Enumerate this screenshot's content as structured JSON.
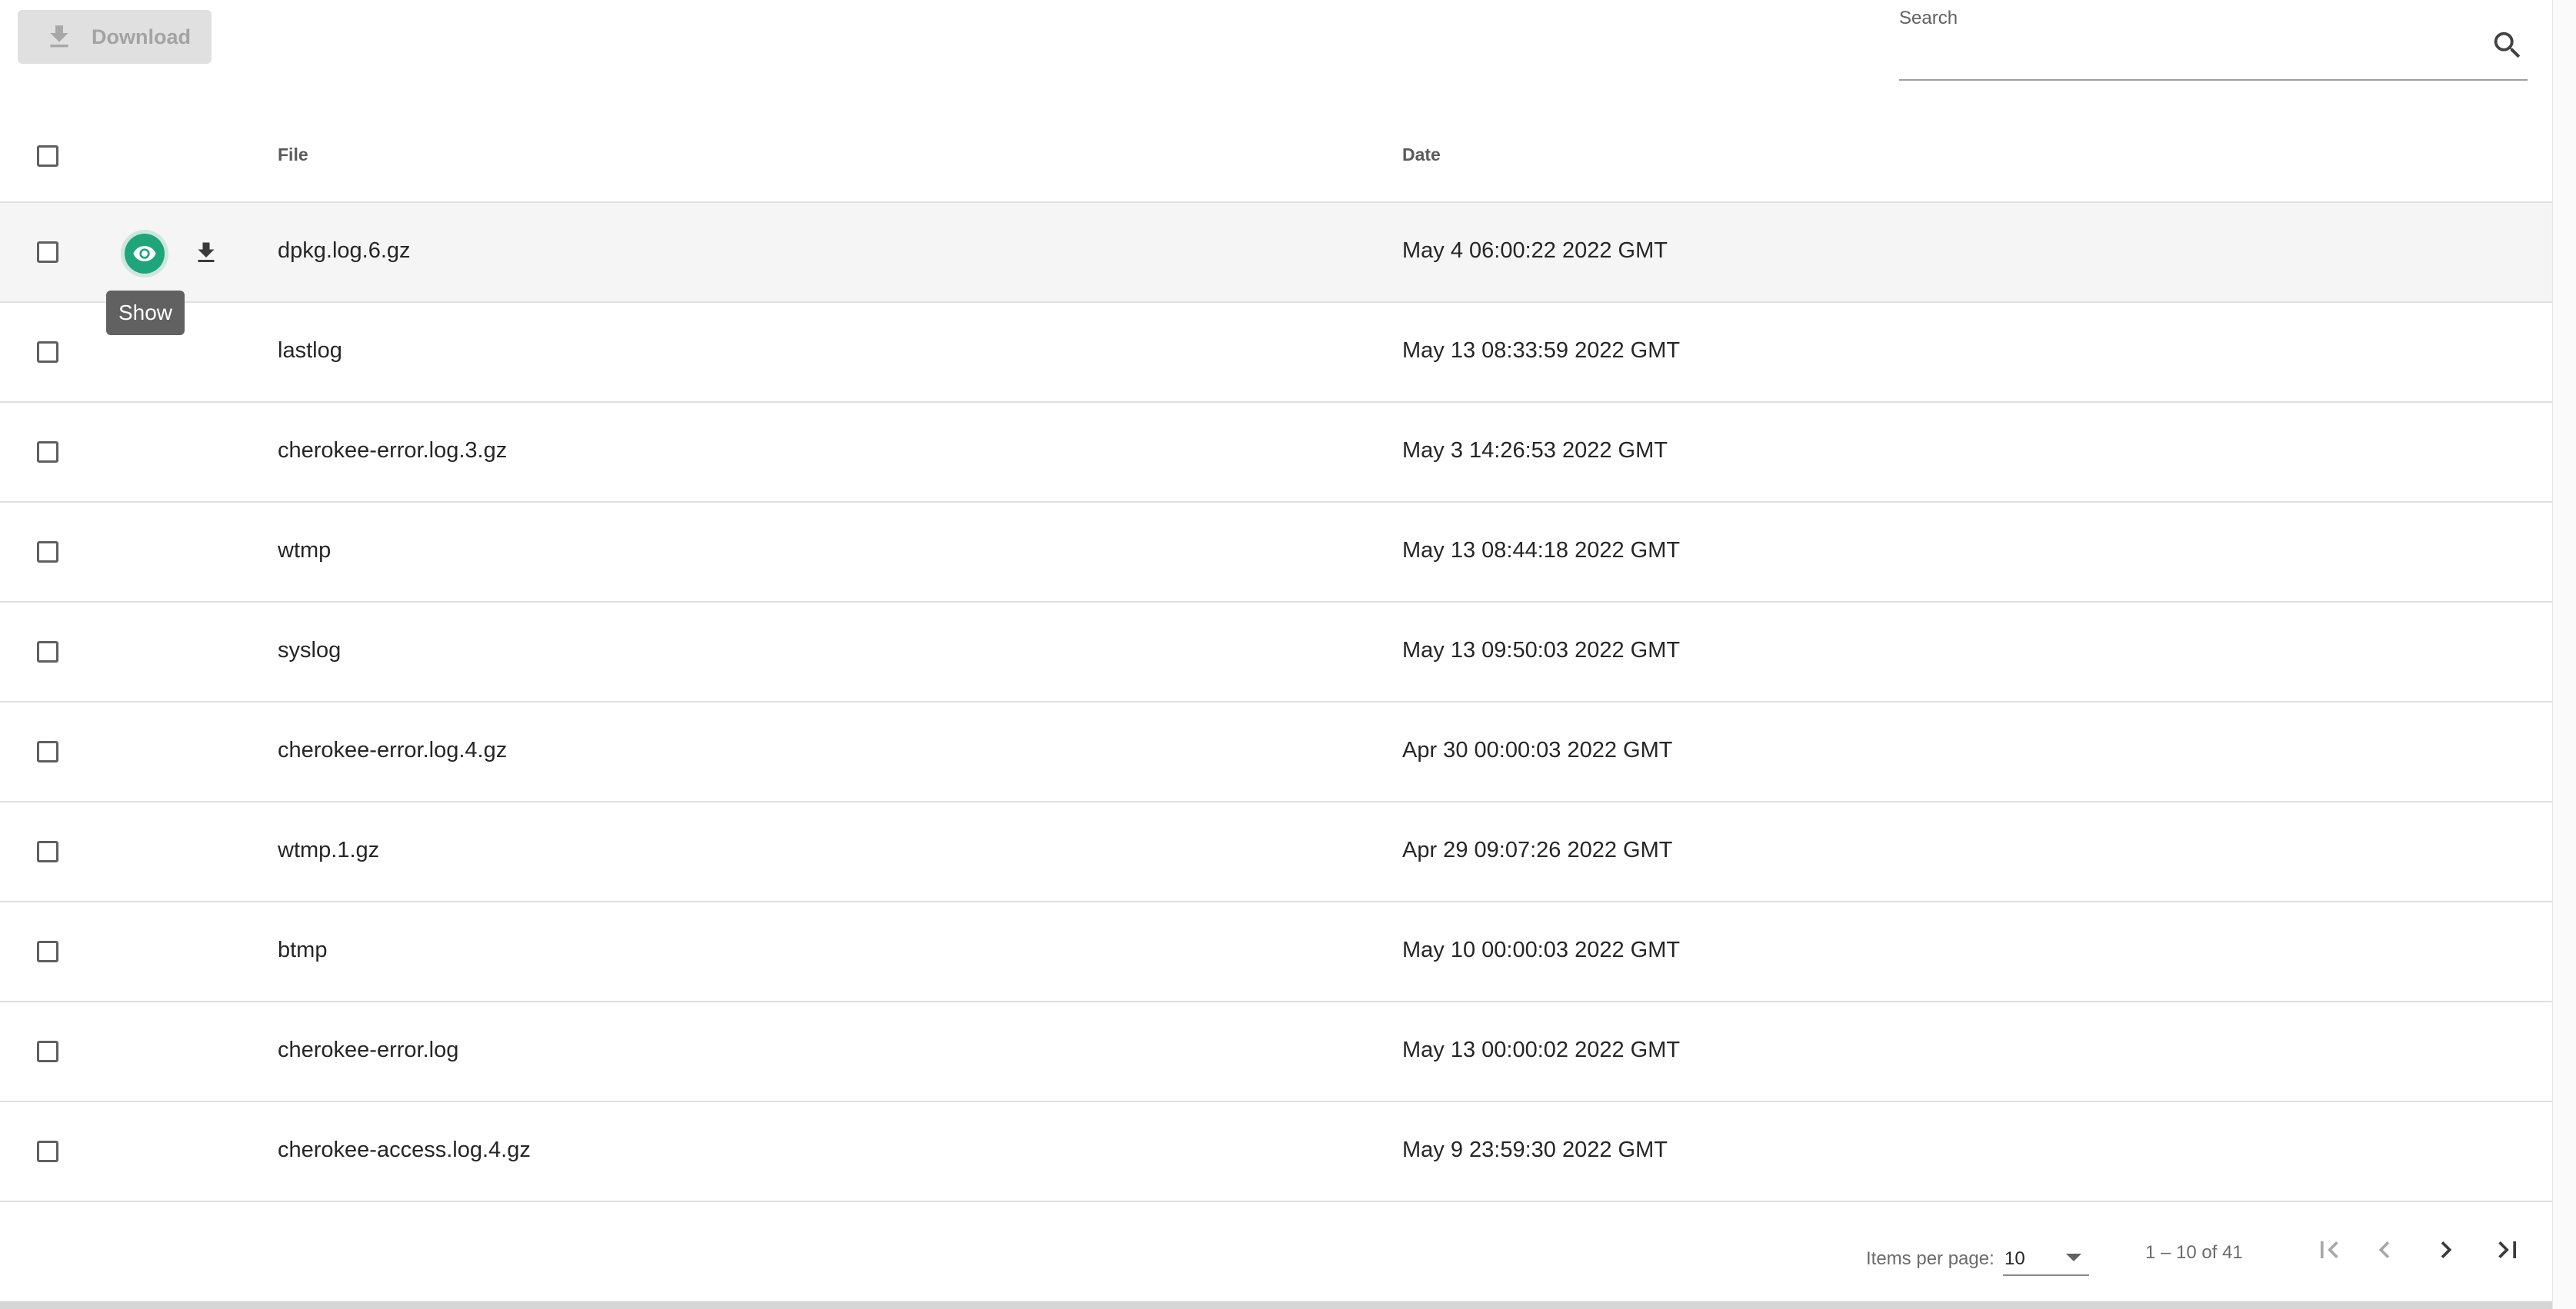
{
  "toolbar": {
    "download_label": "Download",
    "download_icon": "download-icon"
  },
  "search": {
    "label": "Search",
    "value": "",
    "icon": "search-icon"
  },
  "table": {
    "columns": {
      "file": "File",
      "date": "Date"
    },
    "rows": [
      {
        "file": "dpkg.log.6.gz",
        "date": "May 4 06:00:22 2022 GMT"
      },
      {
        "file": "lastlog",
        "date": "May 13 08:33:59 2022 GMT"
      },
      {
        "file": "cherokee-error.log.3.gz",
        "date": "May 3 14:26:53 2022 GMT"
      },
      {
        "file": "wtmp",
        "date": "May 13 08:44:18 2022 GMT"
      },
      {
        "file": "syslog",
        "date": "May 13 09:50:03 2022 GMT"
      },
      {
        "file": "cherokee-error.log.4.gz",
        "date": "Apr 30 00:00:03 2022 GMT"
      },
      {
        "file": "wtmp.1.gz",
        "date": "Apr 29 09:07:26 2022 GMT"
      },
      {
        "file": "btmp",
        "date": "May 10 00:00:03 2022 GMT"
      },
      {
        "file": "cherokee-error.log",
        "date": "May 13 00:00:02 2022 GMT"
      },
      {
        "file": "cherokee-access.log.4.gz",
        "date": "May 9 23:59:30 2022 GMT"
      }
    ],
    "row_actions": {
      "show_icon": "eye-icon",
      "download_icon": "download-icon"
    },
    "tooltip": "Show"
  },
  "paginator": {
    "items_per_page_label": "Items per page:",
    "items_per_page_value": "10",
    "range_label": "1 – 10 of 41",
    "icons": [
      "first-page-icon",
      "previous-page-icon",
      "next-page-icon",
      "last-page-icon"
    ]
  },
  "colors": {
    "accent": "#1fa57a",
    "tooltip_bg": "#616161",
    "disabled_button_bg": "#e0e0e0",
    "disabled_text": "#a3a3a3"
  }
}
